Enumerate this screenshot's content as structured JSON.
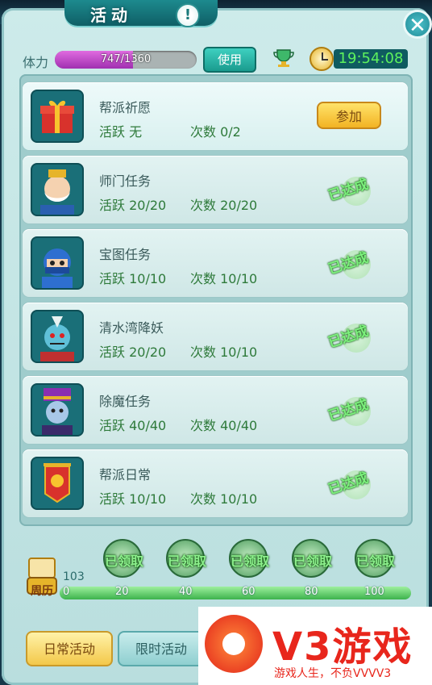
{
  "header": {
    "title": "活动",
    "info_symbol": "!",
    "close_symbol": "✕"
  },
  "stamina": {
    "label": "体力",
    "text": "747/1360",
    "fill_fraction": 0.549,
    "use_label": "使用"
  },
  "timer": {
    "value": "19:54:08"
  },
  "activities": [
    {
      "name": "帮派祈愿",
      "active_text": "活跃 无",
      "count_text": "次数 0/2",
      "status": "join",
      "button": "参加",
      "icon": "gift-box-icon"
    },
    {
      "name": "师门任务",
      "active_text": "活跃 20/20",
      "count_text": "次数 20/20",
      "status": "done",
      "stamp": "已达成",
      "icon": "old-master-portrait"
    },
    {
      "name": "宝图任务",
      "active_text": "活跃 10/10",
      "count_text": "次数 10/10",
      "status": "done",
      "stamp": "已达成",
      "icon": "ninja-portrait"
    },
    {
      "name": "清水湾降妖",
      "active_text": "活跃 20/20",
      "count_text": "次数 10/10",
      "status": "done",
      "stamp": "已达成",
      "icon": "demon-portrait"
    },
    {
      "name": "除魔任务",
      "active_text": "活跃 40/40",
      "count_text": "次数 40/40",
      "status": "done",
      "stamp": "已达成",
      "icon": "zombie-official-portrait"
    },
    {
      "name": "帮派日常",
      "active_text": "活跃 10/10",
      "count_text": "次数 10/10",
      "status": "done",
      "stamp": "已达成",
      "icon": "guild-banner-icon"
    }
  ],
  "weekly": {
    "label": "周历",
    "points": "103",
    "ticks": [
      "0",
      "20",
      "40",
      "60",
      "80",
      "100"
    ],
    "progress_fraction": 1.0,
    "rewards": [
      "已领取",
      "已领取",
      "已领取",
      "已领取",
      "已领取"
    ]
  },
  "tabs": {
    "daily": "日常活动",
    "limited": "限时活动"
  },
  "watermark": {
    "big": "V3游戏",
    "small": "游戏人生，不负VVVV3"
  },
  "colors": {
    "accent_green": "#2e7a3a",
    "timer_green": "#5df25d",
    "stamina_purple": "#c050c8",
    "join_gold": "#f2b323"
  }
}
